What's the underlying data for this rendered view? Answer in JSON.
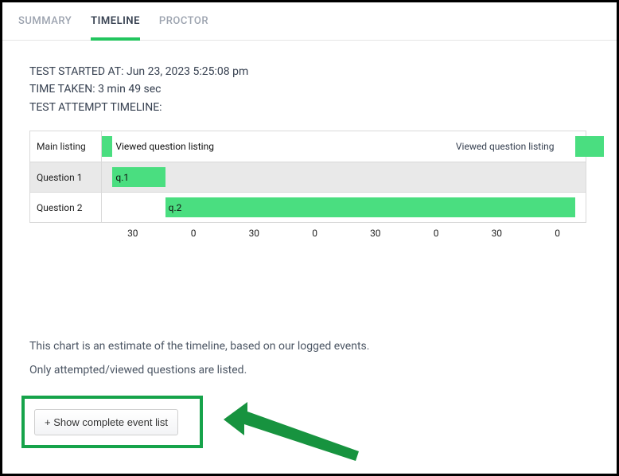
{
  "tabs": {
    "summary": "SUMMARY",
    "timeline": "TIMELINE",
    "proctor": "PROCTOR"
  },
  "meta": {
    "started_label": "TEST STARTED AT:",
    "started_value": "Jun 23, 2023 5:25:08 pm",
    "time_taken_label": "TIME TAKEN:",
    "time_taken_value": "3 min 49 sec",
    "attempt_label": "TEST ATTEMPT TIMELINE:"
  },
  "chart_data": {
    "type": "bar",
    "x_unit": "seconds",
    "x_range": [
      0,
      229
    ],
    "rows": [
      {
        "label": "Main listing",
        "bars": [
          {
            "label": "Viewed question listing",
            "start": 0,
            "end": 5
          },
          {
            "label": "Viewed question listing",
            "start": 224,
            "end": 229
          }
        ]
      },
      {
        "label": "Question 1",
        "bars": [
          {
            "label": "q.1",
            "start": 5,
            "end": 30
          }
        ]
      },
      {
        "label": "Question 2",
        "bars": [
          {
            "label": "q.2",
            "start": 30,
            "end": 224
          }
        ]
      }
    ],
    "axis_ticks": [
      "30",
      "0",
      "30",
      "0",
      "30",
      "0",
      "30",
      "0"
    ]
  },
  "notes": {
    "line1": "This chart is an estimate of the timeline, based on our logged events.",
    "line2": "Only attempted/viewed questions are listed."
  },
  "button": {
    "label": "+ Show complete event list"
  }
}
